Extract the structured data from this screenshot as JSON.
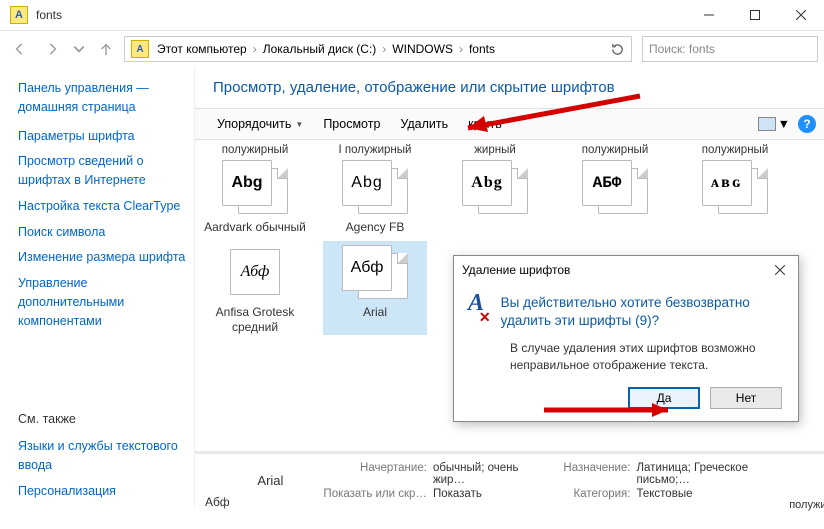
{
  "title": "fonts",
  "path": {
    "segments": [
      "Этот компьютер",
      "Локальный диск (C:)",
      "WINDOWS",
      "fonts"
    ]
  },
  "search": {
    "placeholder": "Поиск: fonts"
  },
  "sidebar": {
    "top": [
      "Панель управления — домашняя страница"
    ],
    "links": [
      "Параметры шрифта",
      "Просмотр сведений о шрифтах в Интернете",
      "Настройка текста ClearType",
      "Поиск символа",
      "Изменение размера шрифта",
      "Управление дополнительными компонентами"
    ],
    "see_header": "См. также",
    "see": [
      "Языки и службы текстового ввода",
      "Персонализация"
    ]
  },
  "main": {
    "title": "Просмотр, удаление, отображение или скрытие шрифтов",
    "toolbar": {
      "organize": "Упорядочить",
      "view": "Просмотр",
      "delete": "Удалить",
      "hide": "крыть"
    },
    "row_labels": [
      "полужирный",
      "I полужирный",
      "жирный",
      "полужирный",
      "полужирный"
    ],
    "fonts_row1": [
      {
        "sample": "Abg",
        "name": "Aardvark обычный",
        "cls": "f-aardvark"
      },
      {
        "sample": "Abg",
        "name": "Agency FB",
        "cls": "f-agency"
      },
      {
        "sample": "Abg",
        "name": "",
        "cls": "f-c3"
      },
      {
        "sample": "АБФ",
        "name": "",
        "cls": "f-c4"
      },
      {
        "sample": "ᴀʙɢ",
        "name": "",
        "cls": "f-c5"
      }
    ],
    "fonts_row2": [
      {
        "sample": "Абф",
        "name": "Anfisa Grotesk средний",
        "cls": "f-anfisa",
        "single": true
      },
      {
        "sample": "Абф",
        "name": "Arial",
        "cls": "f-arial",
        "sel": true
      }
    ],
    "hidden_label": "полужирный"
  },
  "dialog": {
    "title": "Удаление шрифтов",
    "message": "Вы действительно хотите безвозвратно удалить эти шрифты (9)?",
    "note": "В случае удаления этих шрифтов возможно неправильное отображение текста.",
    "yes": "Да",
    "no": "Нет"
  },
  "details": {
    "name": "Arial",
    "l1": "Начертание:",
    "v1": "обычный; очень жир…",
    "l2": "Показать или скр…",
    "v2": "Показать",
    "l3": "Назначение:",
    "v3": "Латиница; Греческое письмо;…",
    "l4": "Категория:",
    "v4": "Текстовые",
    "thumb": "Абф"
  }
}
